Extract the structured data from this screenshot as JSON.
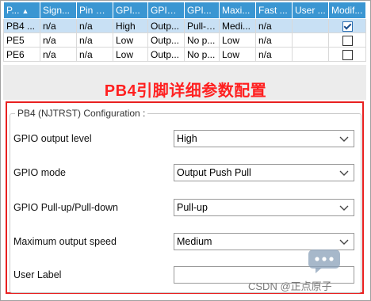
{
  "table": {
    "headers": [
      "P...",
      "Sign...",
      "Pin C...",
      "GPI...",
      "GPIO...",
      "GPI...",
      "Maxi...",
      "Fast ...",
      "User ...",
      "Modif..."
    ],
    "rows": [
      {
        "cells": [
          "PB4 ...",
          "n/a",
          "n/a",
          "High",
          "Outp...",
          "Pull-up",
          "Medi...",
          "n/a",
          ""
        ],
        "modified": true
      },
      {
        "cells": [
          "PE5",
          "n/a",
          "n/a",
          "Low",
          "Outp...",
          "No p...",
          "Low",
          "n/a",
          ""
        ],
        "modified": false
      },
      {
        "cells": [
          "PE6",
          "n/a",
          "n/a",
          "Low",
          "Outp...",
          "No p...",
          "Low",
          "n/a",
          ""
        ],
        "modified": false
      }
    ]
  },
  "annotation": "PB4引脚详细参数配置",
  "config": {
    "legend": "PB4 (NJTRST) Configuration :",
    "fields": [
      {
        "label": "GPIO output level",
        "value": "High"
      },
      {
        "label": "GPIO mode",
        "value": "Output Push Pull"
      },
      {
        "label": "GPIO Pull-up/Pull-down",
        "value": "Pull-up"
      },
      {
        "label": "Maximum output speed",
        "value": "Medium"
      }
    ],
    "user_label": {
      "label": "User Label",
      "value": ""
    }
  },
  "watermark": "CSDN @正点原子"
}
